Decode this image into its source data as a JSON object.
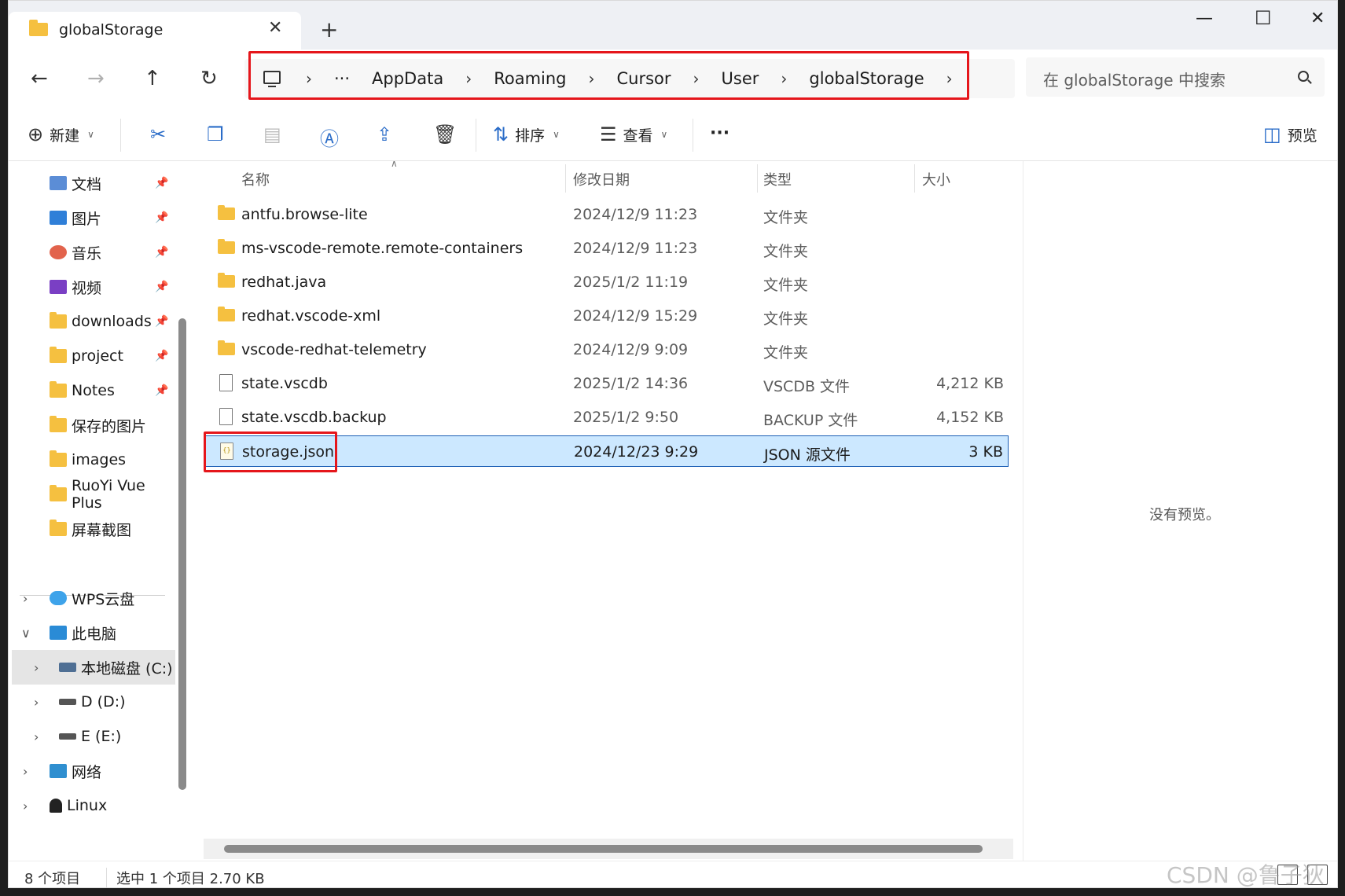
{
  "window": {
    "tab_title": "globalStorage",
    "tab_close": "✕",
    "new_tab": "+",
    "minimize": "—",
    "maximize": "☐",
    "close": "✕"
  },
  "nav": {
    "back": "←",
    "forward": "→",
    "up": "↑",
    "refresh": "↻"
  },
  "breadcrumb": {
    "ellipsis": "···",
    "sep": "›",
    "items": [
      "AppData",
      "Roaming",
      "Cursor",
      "User",
      "globalStorage"
    ]
  },
  "search": {
    "placeholder": "在 globalStorage 中搜索"
  },
  "toolbar": {
    "new_label": "新建",
    "sort_label": "排序",
    "view_label": "查看",
    "more_label": "···",
    "preview_label": "预览"
  },
  "sidebar": {
    "quick_access": [
      {
        "label": "文档",
        "icon": "document-icon",
        "color": "#5b8dd6"
      },
      {
        "label": "图片",
        "icon": "pictures-icon",
        "color": "#2f7fd8"
      },
      {
        "label": "音乐",
        "icon": "music-icon",
        "color": "#e2634c"
      },
      {
        "label": "视频",
        "icon": "video-icon",
        "color": "#7a3fc4"
      },
      {
        "label": "downloads",
        "icon": "folder-icon",
        "color": "#f5c040"
      },
      {
        "label": "project",
        "icon": "folder-icon",
        "color": "#f5c040"
      },
      {
        "label": "Notes",
        "icon": "folder-icon",
        "color": "#f5c040"
      },
      {
        "label": "保存的图片",
        "icon": "folder-icon",
        "color": "#f5c040"
      },
      {
        "label": "images",
        "icon": "folder-icon",
        "color": "#f5c040"
      },
      {
        "label": "RuoYi Vue Plus",
        "icon": "folder-icon",
        "color": "#f5c040"
      },
      {
        "label": "屏幕截图",
        "icon": "folder-icon",
        "color": "#f5c040"
      }
    ],
    "wps": "WPS云盘",
    "this_pc": "此电脑",
    "drive_c": "本地磁盘 (C:)",
    "drive_d": "D (D:)",
    "drive_e": "E (E:)",
    "network": "网络",
    "linux": "Linux"
  },
  "columns": {
    "name": "名称",
    "date": "修改日期",
    "type": "类型",
    "size": "大小"
  },
  "files": [
    {
      "name": "antfu.browse-lite",
      "date": "2024/12/9 11:23",
      "type": "文件夹",
      "size": "",
      "kind": "folder"
    },
    {
      "name": "ms-vscode-remote.remote-containers",
      "date": "2024/12/9 11:23",
      "type": "文件夹",
      "size": "",
      "kind": "folder"
    },
    {
      "name": "redhat.java",
      "date": "2025/1/2 11:19",
      "type": "文件夹",
      "size": "",
      "kind": "folder"
    },
    {
      "name": "redhat.vscode-xml",
      "date": "2024/12/9 15:29",
      "type": "文件夹",
      "size": "",
      "kind": "folder"
    },
    {
      "name": "vscode-redhat-telemetry",
      "date": "2024/12/9 9:09",
      "type": "文件夹",
      "size": "",
      "kind": "folder"
    },
    {
      "name": "state.vscdb",
      "date": "2025/1/2 14:36",
      "type": "VSCDB 文件",
      "size": "4,212 KB",
      "kind": "doc"
    },
    {
      "name": "state.vscdb.backup",
      "date": "2025/1/2 9:50",
      "type": "BACKUP 文件",
      "size": "4,152 KB",
      "kind": "doc"
    },
    {
      "name": "storage.json",
      "date": "2024/12/23 9:29",
      "type": "JSON 源文件",
      "size": "3 KB",
      "kind": "json",
      "selected": true
    }
  ],
  "preview": {
    "message": "没有预览。"
  },
  "status": {
    "count": "8 个项目",
    "selection": "选中 1 个项目  2.70 KB"
  },
  "watermark": "CSDN @鲁子狄",
  "colors": {
    "accent": "#2a6cc8",
    "selection": "#cce8ff",
    "highlight": "#e5161b",
    "folder": "#f5c040"
  }
}
